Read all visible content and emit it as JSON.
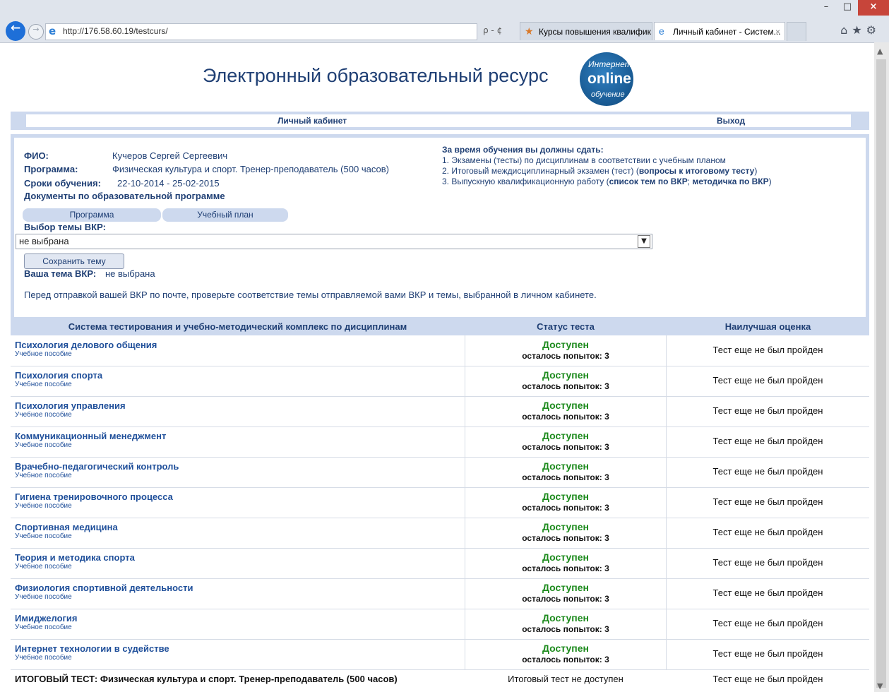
{
  "browser": {
    "url": "http://176.58.60.19/testcurs/",
    "tabs": [
      {
        "label": "Курсы повышения квалифик..."
      },
      {
        "label": "Личный кабинет - Систем...",
        "close": "×"
      }
    ],
    "search_glyph": "ρ - ¢"
  },
  "site": {
    "title": "Электронный образовательный ресурс",
    "logo": {
      "top": "Интернет",
      "middle": "online",
      "bottom": "обучение"
    }
  },
  "nav": {
    "cabinet": "Личный кабинет",
    "exit": "Выход"
  },
  "student": {
    "fio_label": "ФИО:",
    "fio": "Кучеров Сергей Сергеевич",
    "program_label": "Программа:",
    "program": "Физическая культура и спорт. Тренер-преподаватель (500 часов)",
    "period_label": "Сроки обучения:",
    "period": "22-10-2014 - 25-02-2015",
    "docs_label": "Документы по образовательной программе",
    "doc_buttons": [
      "Программа",
      "Учебный план"
    ],
    "vkr_choice_label": "Выбор темы ВКР:",
    "vkr_select_value": "не выбрана",
    "save_button": "Сохранить тему",
    "your_vkr_label": "Ваша тема ВКР:",
    "your_vkr_value": "не выбрана",
    "note": "Перед отправкой вашей ВКР по почте, проверьте соответствие темы отправляемой вами ВКР и темы, выбранной в личном кабинете."
  },
  "requirements": {
    "heading": "За время обучения вы должны сдать:",
    "item1": "1. Экзамены (тесты) по дисциплинам в соответствии с учебным планом",
    "item2_text": "2. Итоговый междисциплинарный экзамен (тест) (",
    "item2_link": "вопросы к итоговому тесту",
    "item2_end": ")",
    "item3_text": "3. Выпускную квалификационную работу (",
    "item3_link1": "список тем по ВКР",
    "item3_sep": "; ",
    "item3_link2": "методичка по ВКР",
    "item3_end": ")"
  },
  "table": {
    "headers": [
      "Система тестирования и учебно-методический комплекс по дисциплинам",
      "Статус теста",
      "Наилучшая оценка"
    ],
    "rows": [
      {
        "subject": "Психология делового общения",
        "manual": "Учебное пособие",
        "status": "Доступен",
        "attempts": "осталось попыток: 3",
        "grade": "Тест еще не был пройден"
      },
      {
        "subject": "Психология спорта",
        "manual": "Учебное пособие",
        "status": "Доступен",
        "attempts": "осталось попыток: 3",
        "grade": "Тест еще не был пройден"
      },
      {
        "subject": "Психология управления",
        "manual": "Учебное пособие",
        "status": "Доступен",
        "attempts": "осталось попыток: 3",
        "grade": "Тест еще не был пройден"
      },
      {
        "subject": "Коммуникационный менеджмент",
        "manual": "Учебное пособие",
        "status": "Доступен",
        "attempts": "осталось попыток: 3",
        "grade": "Тест еще не был пройден"
      },
      {
        "subject": "Врачебно-педагогический контроль",
        "manual": "Учебное пособие",
        "status": "Доступен",
        "attempts": "осталось попыток: 3",
        "grade": "Тест еще не был пройден"
      },
      {
        "subject": "Гигиена тренировочного процесса",
        "manual": "Учебное пособие",
        "status": "Доступен",
        "attempts": "осталось попыток: 3",
        "grade": "Тест еще не был пройден"
      },
      {
        "subject": "Спортивная медицина",
        "manual": "Учебное пособие",
        "status": "Доступен",
        "attempts": "осталось попыток: 3",
        "grade": "Тест еще не был пройден"
      },
      {
        "subject": "Теория и методика спорта",
        "manual": "Учебное пособие",
        "status": "Доступен",
        "attempts": "осталось попыток: 3",
        "grade": "Тест еще не был пройден"
      },
      {
        "subject": "Физиология спортивной деятельности",
        "manual": "Учебное пособие",
        "status": "Доступен",
        "attempts": "осталось попыток: 3",
        "grade": "Тест еще не был пройден"
      },
      {
        "subject": "Имиджелогия",
        "manual": "Учебное пособие",
        "status": "Доступен",
        "attempts": "осталось попыток: 3",
        "grade": "Тест еще не был пройден"
      },
      {
        "subject": "Интернет технологии в судействе",
        "manual": "Учебное пособие",
        "status": "Доступен",
        "attempts": "осталось попыток: 3",
        "grade": "Тест еще не был пройден"
      }
    ],
    "final": {
      "label_bold": "ИТОГОВЫЙ ТЕСТ",
      "label_rest": ": Физическая культура и спорт. Тренер-преподаватель (500 часов)",
      "status": "Итоговый тест не доступен",
      "grade": "Тест еще не был пройден"
    }
  },
  "colors": {
    "accent": "#cdd9ee",
    "title": "#1f3f74",
    "link": "#1f4f9a",
    "available": "#1c8a1c"
  }
}
